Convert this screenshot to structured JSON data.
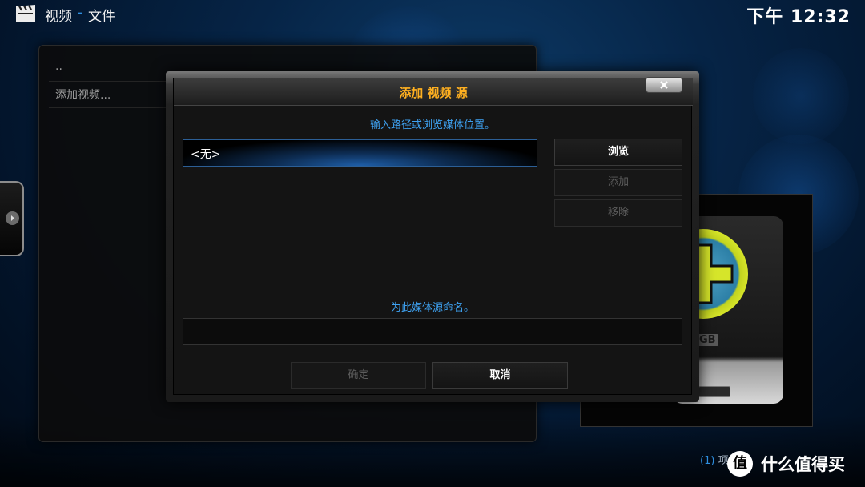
{
  "header": {
    "section": "视频",
    "separator": "-",
    "subsection": "文件",
    "clock": "下午 12:32"
  },
  "file_list": {
    "items": [
      {
        "label": ".."
      },
      {
        "label": "添加视频..."
      }
    ]
  },
  "thumbnail": {
    "label": "GB"
  },
  "dialog": {
    "title": "添加 视频 源",
    "path_prompt": "输入路径或浏览媒体位置。",
    "path_value": "<无>",
    "buttons": {
      "browse": "浏览",
      "add": "添加",
      "remove": "移除"
    },
    "name_prompt": "为此媒体源命名。",
    "name_value": "",
    "ok": "确定",
    "cancel": "取消"
  },
  "footer": {
    "count_prefix": "(1)",
    "count_text": "项",
    "watermark_logo": "值",
    "watermark": "什么值得买"
  },
  "colors": {
    "title": "#ffb020",
    "accent": "#3ea1f0",
    "background": "#062446"
  }
}
